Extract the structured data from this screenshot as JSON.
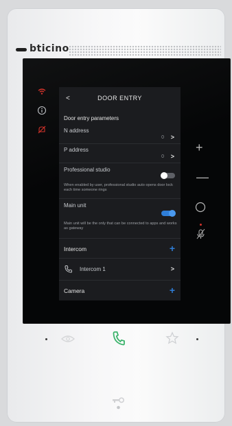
{
  "brand": {
    "name": "bticino"
  },
  "header": {
    "back": "<",
    "title": "DOOR ENTRY"
  },
  "section_title": "Door entry parameters",
  "n_address": {
    "label": "N address",
    "value": "0"
  },
  "p_address": {
    "label": "P address",
    "value": "0"
  },
  "professional_studio": {
    "label": "Professional studio",
    "desc": "When enabled by user, professional studio auto opens door lock each time someone rings",
    "enabled": false
  },
  "main_unit": {
    "label": "Main unit",
    "desc": "Main unit will be the only that can be connected to apps and works as gateway",
    "enabled": true
  },
  "intercom": {
    "label": "Intercom",
    "items": [
      {
        "label": "Intercom 1"
      }
    ]
  },
  "camera": {
    "label": "Camera"
  },
  "icons": {
    "sidebar": [
      "wifi-icon",
      "info-icon",
      "mute-icon"
    ],
    "right": [
      "plus-icon",
      "minus-icon",
      "circle-icon",
      "mic-mute-icon"
    ],
    "bottom": [
      "eye-icon",
      "phone-icon",
      "star-icon",
      "key-icon"
    ]
  },
  "colors": {
    "accent": "#2f7ed8",
    "alert": "#d2332b",
    "phone_green": "#3bb36b",
    "panel_bg": "#1b1c1f"
  }
}
